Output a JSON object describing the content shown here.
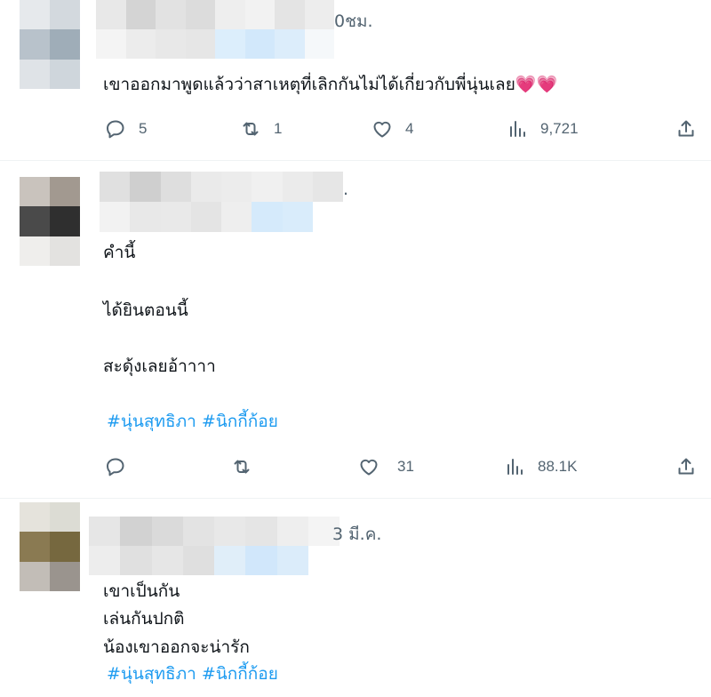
{
  "tweets": [
    {
      "meta_tail": "0ชม.",
      "lines": [
        "เขาออกมาพูดแล้วว่าสาเหตุที่เลิกกันไม่ได้เกี่ยวกับพี่นุ่นเลย"
      ],
      "emoji": "💗💗",
      "actions": {
        "reply": "5",
        "retweet": "1",
        "like": "4",
        "views": "9,721"
      }
    },
    {
      "meta_tail": ".",
      "lines": [
        "คำนี้",
        "ได้ยินตอนนี้",
        "สะดุ้งเลยอ้าาาา"
      ],
      "hashtags": [
        "#นุ่นสุทธิภา",
        "#นิกกี้ก้อย"
      ],
      "actions": {
        "reply": "",
        "retweet": "",
        "like": "31",
        "views": "88.1K"
      }
    },
    {
      "meta_tail": "3 มี.ค.",
      "lines": [
        "เขาเป็นกัน",
        "เล่นกันปกติ",
        "น้องเขาออกจะน่ารัก"
      ],
      "hashtags": [
        "#นุ่นสุทธิภา",
        "#นิกกี้ก้อย"
      ]
    }
  ],
  "icons": {
    "reply": "reply-icon",
    "retweet": "retweet-icon",
    "like": "heart-icon",
    "views": "views-icon",
    "share": "share-icon"
  },
  "colors": {
    "text": "#0f1419",
    "secondary": "#536471",
    "hashtag": "#1d9bf0",
    "divider": "#eff3f4"
  }
}
